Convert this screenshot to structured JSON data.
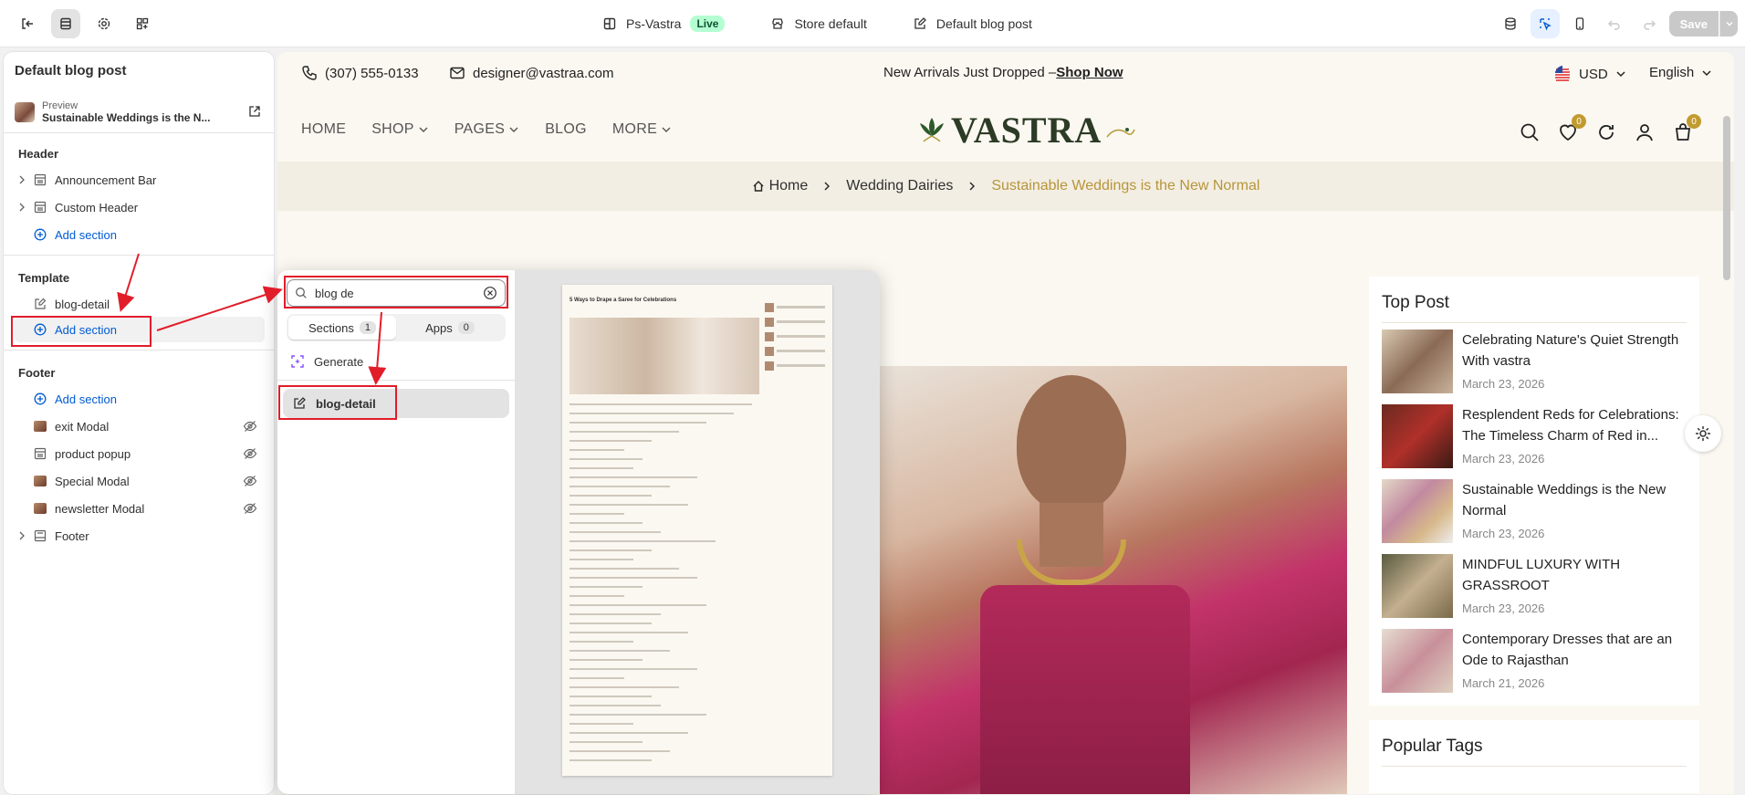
{
  "topbar": {
    "store_name": "Ps-Vastra",
    "live_label": "Live",
    "theme": "Store default",
    "template": "Default blog post",
    "save_label": "Save"
  },
  "sidebar": {
    "title": "Default blog post",
    "preview_label": "Preview",
    "preview_title": "Sustainable Weddings is the N...",
    "header_group": "Header",
    "header_items": [
      "Announcement Bar",
      "Custom Header"
    ],
    "add_section": "Add section",
    "template_group": "Template",
    "template_items": [
      "blog-detail"
    ],
    "footer_group": "Footer",
    "footer_items": [
      "exit Modal",
      "product popup",
      "Special Modal",
      "newsletter Modal",
      "Footer"
    ]
  },
  "popover": {
    "search_value": "blog de",
    "tabs": [
      {
        "label": "Sections",
        "count": "1"
      },
      {
        "label": "Apps",
        "count": "0"
      }
    ],
    "generate_label": "Generate",
    "result_label": "blog-detail",
    "preview_title": "5 Ways to Drape a Saree for Celebrations"
  },
  "store": {
    "phone": "(307) 555-0133",
    "email": "designer@vastraa.com",
    "announcement": "New Arrivals Just Dropped –",
    "shop_now": "Shop Now",
    "currency": "USD",
    "language": "English",
    "nav": [
      "HOME",
      "SHOP",
      "PAGES",
      "BLOG",
      "MORE"
    ],
    "logo": "VASTRA",
    "wishlist_count": "0",
    "cart_count": "0",
    "breadcrumb": [
      "Home",
      "Wedding Dairies",
      "Sustainable Weddings is the New Normal"
    ],
    "top_post_title": "Top Post",
    "posts": [
      {
        "title": "Celebrating Nature's Quiet Strength With vastra",
        "date": "March 23, 2026"
      },
      {
        "title": "Resplendent Reds for Celebrations: The Timeless Charm of Red in...",
        "date": "March 23, 2026"
      },
      {
        "title": "Sustainable Weddings is the New Normal",
        "date": "March 23, 2026"
      },
      {
        "title": "MINDFUL LUXURY WITH GRASSROOT",
        "date": "March 23, 2026"
      },
      {
        "title": "Contemporary Dresses that are an Ode to Rajasthan",
        "date": "March 21, 2026"
      }
    ],
    "popular_tags_title": "Popular Tags"
  },
  "colors": {
    "accent": "#005bd3",
    "annotation": "#e11d2a",
    "gold": "#b6953a"
  }
}
